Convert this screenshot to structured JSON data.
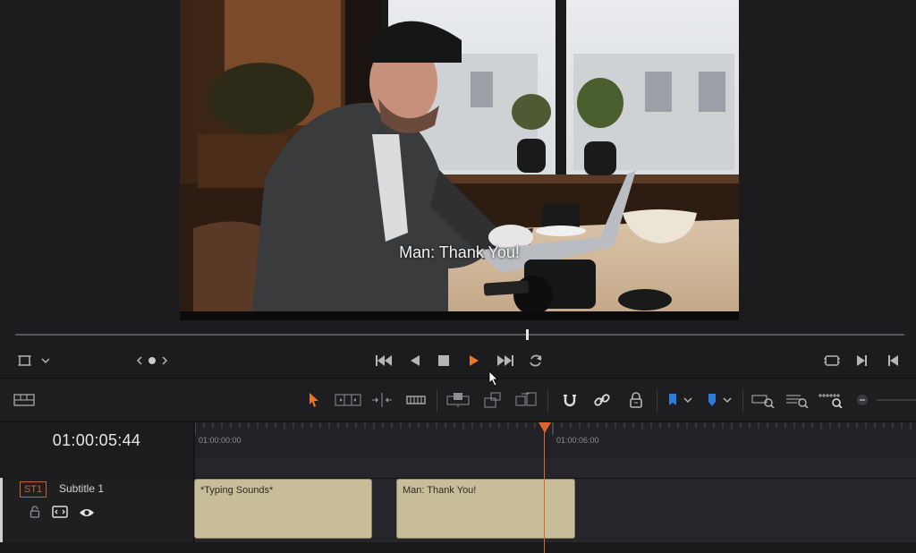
{
  "viewer": {
    "subtitle_overlay": "Man: Thank You!"
  },
  "transport": {
    "view_options_icon": "crop-frame-icon",
    "nav_icon": "prev-dot-next-icon",
    "buttons": [
      "skip-to-start-icon",
      "reverse-play-icon",
      "stop-icon",
      "play-icon",
      "skip-to-end-icon",
      "loop-icon"
    ],
    "right_buttons": [
      "match-frame-icon",
      "next-edit-icon",
      "prev-edit-icon"
    ],
    "accent": "#e8762c"
  },
  "toolbar": {
    "tools": [
      "selection-icon",
      "trim-edit-icon",
      "dynamic-trim-icon",
      "blade-icon",
      "insert-clip-icon",
      "overwrite-clip-icon",
      "replace-clip-icon",
      "snapping-icon",
      "linked-selection-icon",
      "position-lock-icon",
      "flag-icon",
      "marker-icon",
      "zoom-full-icon",
      "zoom-detail-icon",
      "zoom-custom-icon"
    ],
    "flag_color": "#2f7bd8",
    "marker_color": "#2f7bd8"
  },
  "timeline": {
    "timecode": "01:00:05:44",
    "ruler_labels": [
      "01:00:00:00",
      "01:00:06:00"
    ],
    "playhead_color": "#d8662e"
  },
  "track": {
    "badge": "ST1",
    "name": "Subtitle 1",
    "clips": [
      {
        "label": "*Typing Sounds*"
      },
      {
        "label": "Man: Thank You!"
      }
    ]
  }
}
